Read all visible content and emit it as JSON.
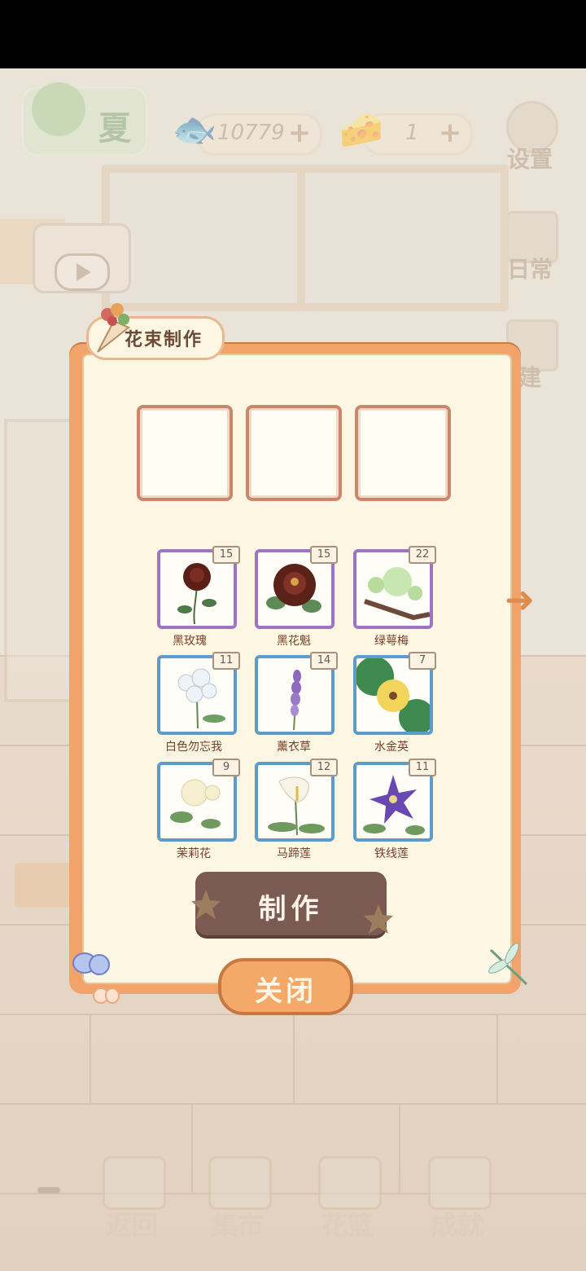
{
  "hud": {
    "season": "夏",
    "coins": "10779",
    "cheese": "1",
    "settings_label": "设置",
    "daily_label": "日常",
    "build_label": "建"
  },
  "dialog": {
    "title": "花束制作",
    "make_label": "制作",
    "close_label": "关闭",
    "flowers": [
      {
        "name": "黑玫瑰",
        "count": "15",
        "frame": "purple"
      },
      {
        "name": "黑花魁",
        "count": "15",
        "frame": "purple"
      },
      {
        "name": "绿萼梅",
        "count": "22",
        "frame": "purple"
      },
      {
        "name": "白色勿忘我",
        "count": "11",
        "frame": "blue"
      },
      {
        "name": "薰衣草",
        "count": "14",
        "frame": "blue"
      },
      {
        "name": "水金英",
        "count": "7",
        "frame": "blue"
      },
      {
        "name": "茉莉花",
        "count": "9",
        "frame": "blue"
      },
      {
        "name": "马蹄莲",
        "count": "12",
        "frame": "blue"
      },
      {
        "name": "铁线莲",
        "count": "11",
        "frame": "blue"
      }
    ]
  },
  "bottom_nav": [
    {
      "label": "返回"
    },
    {
      "label": "集市"
    },
    {
      "label": "花篮"
    },
    {
      "label": "成就"
    }
  ],
  "colors": {
    "dialog_frame": "#f2a36a",
    "dialog_bg": "#fdf6e3",
    "make_button": "#7a5a52",
    "purple_frame": "#9d74c4",
    "blue_frame": "#5d9cc9"
  }
}
